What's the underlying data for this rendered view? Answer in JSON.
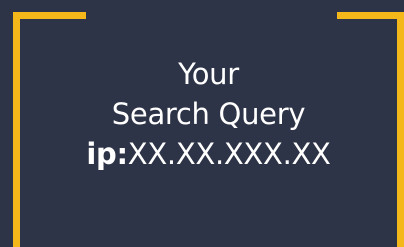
{
  "card": {
    "line1": "Your",
    "line2": "Search Query",
    "query_prefix": "ip:",
    "query_value": "XX.XX.XXX.XX"
  },
  "colors": {
    "background": "#2e3447",
    "accent": "#f4b81a",
    "text": "#ffffff"
  }
}
